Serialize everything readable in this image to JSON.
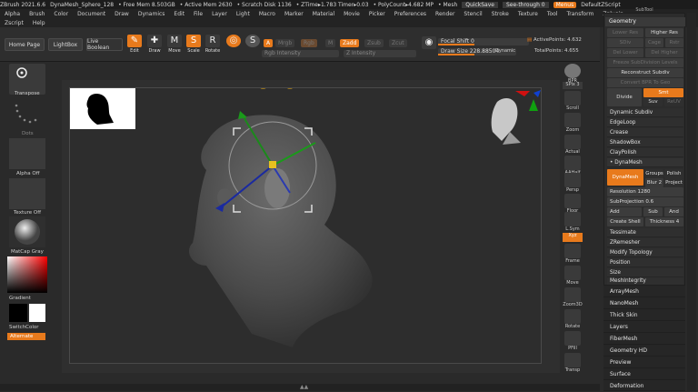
{
  "title": {
    "app": "ZBrush 2021.6.6",
    "file": "DynaMesh_Sphere_128",
    "free_mem": "• Free Mem 8.503GB",
    "active_mem": "• Active Mem 2630",
    "scratch": "• Scratch Disk 1136",
    "ztime": "• ZTime▸1.783 Timer▸0.03",
    "polycount": "• PolyCount▸4.682 MP",
    "mesh": "• Mesh",
    "quicksave": "QuickSave",
    "seethrough": "See-through 0",
    "menus": "Menus",
    "script": "DefaultZScript"
  },
  "menu_row1": [
    "Alpha",
    "Brush",
    "Color",
    "Document",
    "Draw",
    "Dynamics",
    "Edit",
    "File",
    "Layer",
    "Light",
    "Macro",
    "Marker",
    "Material",
    "Movie",
    "Picker",
    "Preferences",
    "Render",
    "Stencil",
    "Stroke",
    "Texture",
    "Tool",
    "Transform",
    "Zplugin"
  ],
  "menu_row2": [
    "Zscript",
    "Help"
  ],
  "toolbar": {
    "home": "Home Page",
    "lightbox": "LightBox",
    "liveboolean": "Live Boolean",
    "edit": "Edit",
    "draw": "Draw",
    "move": "Move",
    "scale": "Scale",
    "rotate": "Rotate",
    "a": "A",
    "mrgb": "Mrgb",
    "rgb": "Rgb",
    "m": "M",
    "zadd": "Zadd",
    "zsub": "Zsub",
    "zcut": "Zcut",
    "rgb_intensity": "Rgb Intensity",
    "z_intensity": "Z Intensity",
    "focal_shift": "Focal Shift 0",
    "draw_size": "Draw Size 228.88504",
    "dynamic": "Dynamic",
    "active_points": "ActivePoints: 4.632",
    "total_points": "TotalPoints: 4.655"
  },
  "leftshelf": {
    "transpose": "Transpose",
    "dots": "Dots",
    "alpha_off": "Alpha Off",
    "texture_off": "Texture Off",
    "matcap": "MatCap Gray",
    "gradient": "Gradient",
    "switchcolor": "SwitchColor",
    "alternate": "Alternate"
  },
  "rightshelf": {
    "bpr": "BPR",
    "spix": "SPix 3",
    "scroll": "Scroll",
    "zoom": "Zoom",
    "actual": "Actual",
    "aahalf": "AAHalf",
    "persp": "Persp",
    "floor": "Floor",
    "lsym": "L.Sym",
    "xyz": "Xyz",
    "frame": "Frame",
    "move": "Move",
    "zoom3d": "Zoom3D",
    "rotate": "Rotate",
    "pfill": "PFill",
    "transp": "Transp"
  },
  "subtool": "SubTool",
  "geometry": {
    "header": "Geometry",
    "lower_res": "Lower Res",
    "higher_res": "Higher Res",
    "sdiv": "SDiv",
    "cage": "Cage",
    "rstr": "Rstr",
    "del_lower": "Del Lower",
    "del_higher": "Del Higher",
    "freeze": "Freeze SubDivision Levels",
    "reconstruct": "Reconstruct Subdiv",
    "convert_bpr": "Convert BPR To Geo",
    "divide": "Divide",
    "smt": "Smt",
    "suv": "Suv",
    "reuv": "ReUV",
    "dynamic_subdiv": "Dynamic Subdiv",
    "edgeloop": "EdgeLoop",
    "crease": "Crease",
    "shadowbox": "ShadowBox",
    "claypolish": "ClayPolish",
    "dynamesh_section": "DynaMesh",
    "dynamesh_btn": "DynaMesh",
    "groups": "Groups",
    "polish": "Polish",
    "blur": "Blur",
    "blur_val": "2",
    "project": "Project",
    "resolution": "Resolution 1280",
    "subprojection": "SubProjection 0.6",
    "add": "Add",
    "sub": "Sub",
    "and": "And",
    "create_shell": "Create Shell",
    "thickness": "Thickness 4",
    "tessimate": "Tessimate",
    "zremesher": "ZRemesher",
    "modify_topology": "Modify Topology",
    "position": "Position",
    "size": "Size",
    "meshintegrity": "MeshIntegrity"
  },
  "subpalettes": [
    "ArrayMesh",
    "NanoMesh",
    "Thick Skin",
    "Layers",
    "FiberMesh",
    "Geometry HD",
    "Preview",
    "Surface",
    "Deformation"
  ],
  "colors": {
    "accent": "#e87a1c",
    "bg": "#2a2a2a"
  }
}
